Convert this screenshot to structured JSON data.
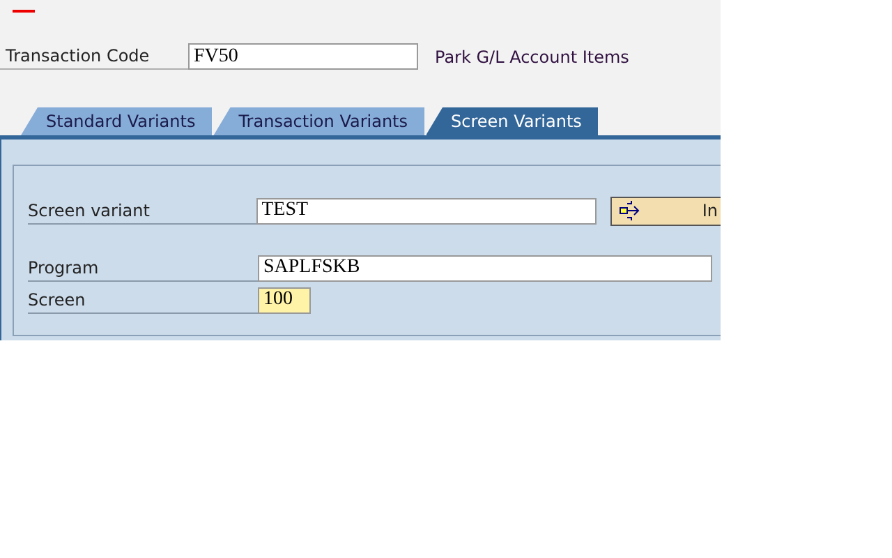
{
  "transaction": {
    "label": "Transaction Code",
    "value": "FV50",
    "description": "Park G/L Account Items"
  },
  "tabs": [
    {
      "label": "Standard Variants",
      "selected": false
    },
    {
      "label": "Transaction Variants",
      "selected": false
    },
    {
      "label": "Screen Variants",
      "selected": true
    }
  ],
  "field_groups": [
    {
      "fields": [
        {
          "label": "Screen variant",
          "value": "TEST",
          "focused": false,
          "kind": "with-button"
        }
      ]
    },
    {
      "fields": [
        {
          "label": "Program",
          "value": "SAPLFSKB",
          "focused": false,
          "kind": "wide"
        },
        {
          "label": "Screen",
          "value": "100",
          "focused": true,
          "kind": "short"
        }
      ]
    }
  ],
  "button": {
    "label": "In"
  }
}
